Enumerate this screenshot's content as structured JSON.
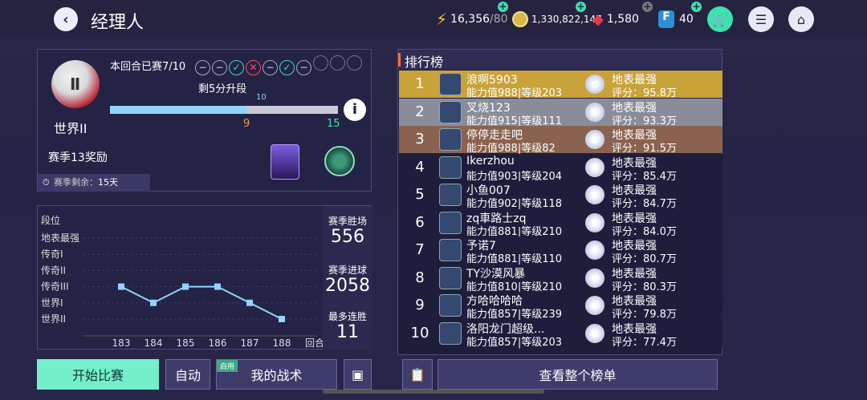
{
  "header": {
    "title": "经理人",
    "stamina": "16,356",
    "stamina_max": "/80",
    "coins": "1,330,822,147",
    "gems": "1,580",
    "f_points": "40"
  },
  "season": {
    "round_label": "本回合已赛7/10",
    "results": [
      "minus",
      "minus",
      "check",
      "cross",
      "minus",
      "check",
      "minus",
      "empty",
      "empty",
      "empty"
    ],
    "promote_label": "剩5分升段",
    "progress_current": "9",
    "progress_marker": "10",
    "progress_target": "15",
    "progress_fraction": 0.6,
    "division_name": "世界II",
    "reward_label": "赛季13奖励",
    "remaining_label": "赛季剩余：",
    "remaining_value": "15天"
  },
  "chart_data": {
    "type": "line",
    "ylabel": "段位",
    "y_categories": [
      "地表最强",
      "传奇I",
      "传奇II",
      "传奇III",
      "世界I",
      "世界II"
    ],
    "x": [
      "183",
      "184",
      "185",
      "186",
      "187",
      "188"
    ],
    "xlabel": "回合",
    "values": [
      "传奇III",
      "世界I",
      "传奇III",
      "传奇III",
      "世界I",
      "世界II"
    ],
    "color": "#8fd4ff"
  },
  "stats": {
    "wins_label": "赛季胜场",
    "wins": "556",
    "goals_label": "赛季进球",
    "goals": "2058",
    "streak_label": "最多连胜",
    "streak": "11"
  },
  "ranking": {
    "title": "排行榜",
    "rows": [
      {
        "rank": "1",
        "name": "浪啊5903",
        "sub": "能力值988|等级203",
        "grade": "地表最强",
        "score": "评分：95.8万",
        "bg": "#c9a23a"
      },
      {
        "rank": "2",
        "name": "叉烧123",
        "sub": "能力值915|等级111",
        "grade": "地表最强",
        "score": "评分：93.3万",
        "bg": "#8a8d99"
      },
      {
        "rank": "3",
        "name": "停停走走吧",
        "sub": "能力值988|等级82",
        "grade": "地表最强",
        "score": "评分：91.5万",
        "bg": "#8a6350"
      },
      {
        "rank": "4",
        "name": "Ikerzhou",
        "sub": "能力值903|等级204",
        "grade": "地表最强",
        "score": "评分：85.4万",
        "bg": "#1f1d3c"
      },
      {
        "rank": "5",
        "name": "小鱼007",
        "sub": "能力值902|等级118",
        "grade": "地表最强",
        "score": "评分：84.7万",
        "bg": "#1f1d3c"
      },
      {
        "rank": "6",
        "name": "zq車路士zq",
        "sub": "能力值881|等级210",
        "grade": "地表最强",
        "score": "评分：84.0万",
        "bg": "#1f1d3c"
      },
      {
        "rank": "7",
        "name": "予诺7",
        "sub": "能力值881|等级110",
        "grade": "地表最强",
        "score": "评分：80.7万",
        "bg": "#1f1d3c"
      },
      {
        "rank": "8",
        "name": "TY沙漠风暴",
        "sub": "能力值810|等级210",
        "grade": "地表最强",
        "score": "评分：80.3万",
        "bg": "#1f1d3c"
      },
      {
        "rank": "9",
        "name": "方哈哈哈哈",
        "sub": "能力值857|等级239",
        "grade": "地表最强",
        "score": "评分：79.8万",
        "bg": "#1f1d3c"
      },
      {
        "rank": "10",
        "name": "洛阳龙门超级...",
        "sub": "能力值857|等级203",
        "grade": "地表最强",
        "score": "评分：77.4万",
        "bg": "#1f1d3c"
      }
    ],
    "view_all": "查看整个榜单"
  },
  "buttons": {
    "start": "开始比赛",
    "auto": "自动",
    "tactics_tag": "启用",
    "tactics": "我的战术"
  }
}
